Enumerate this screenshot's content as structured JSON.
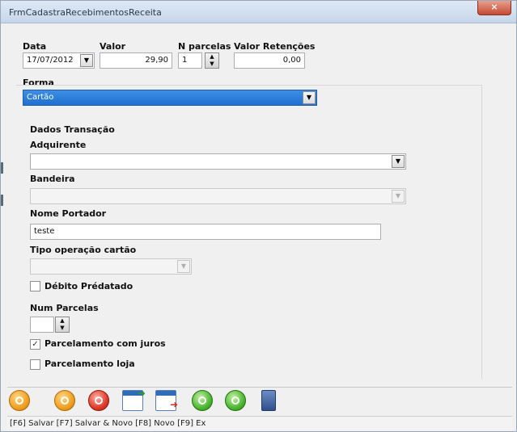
{
  "window": {
    "title": "FrmCadastraRecebimentosReceita",
    "close_label": "×"
  },
  "header": {
    "data_label": "Data",
    "data_value": "17/07/2012",
    "valor_label": "Valor",
    "valor_value": "29,90",
    "nparcelas_label": "N parcelas",
    "nparcelas_value": "1",
    "retencoes_label": "Valor Retenções",
    "retencoes_value": "0,00",
    "forma_label": "Forma",
    "forma_value": "Cartão"
  },
  "transacao": {
    "title": "Dados Transação",
    "adquirente_label": "Adquirente",
    "adquirente_value": "",
    "bandeira_label": "Bandeira",
    "bandeira_value": "",
    "nome_portador_label": "Nome Portador",
    "nome_portador_value": "teste",
    "tipo_operacao_label": "Tipo operação cartão",
    "tipo_operacao_value": "",
    "debito_predatado_label": "Débito Prédatado",
    "debito_predatado_checked": false,
    "num_parcelas_label": "Num Parcelas",
    "num_parcelas_value": "",
    "parcelamento_juros_label": "Parcelamento com juros",
    "parcelamento_juros_checked": true,
    "parcelamento_loja_label": "Parcelamento loja",
    "parcelamento_loja_checked": false
  },
  "toolbar": {
    "icons": [
      "save-icon",
      "save-new-icon",
      "new-icon",
      "add-document-icon",
      "remove-document-icon",
      "previous-icon",
      "next-icon",
      "exit-icon"
    ]
  },
  "status": {
    "text": "[F6] Salvar [F7] Salvar & Novo [F8] Novo [F9] Ex"
  },
  "colors": {
    "selection": "#1f6fd0",
    "titlebar": "#c6d6ea",
    "close": "#c44a32"
  }
}
